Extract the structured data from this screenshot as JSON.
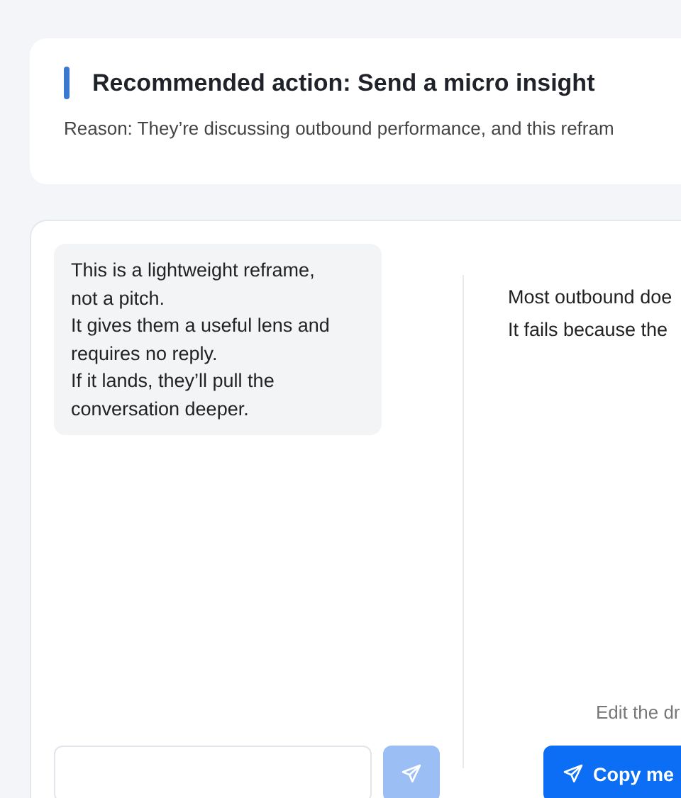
{
  "recommendation": {
    "title": "Recommended action: Send a micro insight",
    "reason": "Reason: They’re discussing outbound performance, and this refram"
  },
  "chat": {
    "bubble": [
      "This is a lightweight reframe,",
      "not a pitch.",
      "It gives them a useful lens and",
      "requires no reply.",
      "If it lands, they’ll pull the",
      "conversation deeper."
    ],
    "send_button": {
      "disabled": true
    }
  },
  "draft": {
    "lines": [
      "Most outbound doe",
      "It fails because the"
    ],
    "hint": "Edit the dr",
    "copy_button": "Copy me"
  }
}
